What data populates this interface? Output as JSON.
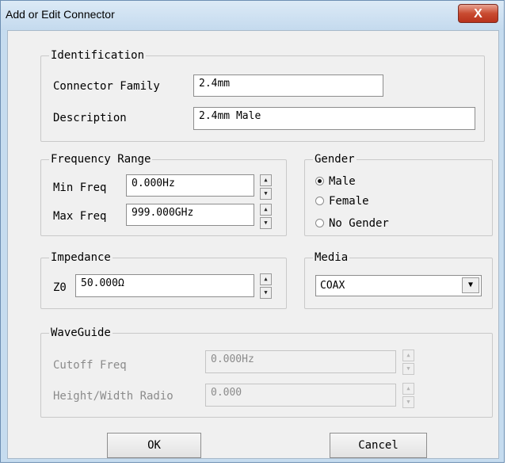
{
  "window": {
    "title": "Add or Edit Connector",
    "close_glyph": "X"
  },
  "identification": {
    "legend": "Identification",
    "family_label": "Connector Family",
    "family_value": "2.4mm",
    "description_label": "Description",
    "description_value": "2.4mm Male"
  },
  "frequency": {
    "legend": "Frequency Range",
    "min_label": "Min Freq",
    "min_value": "0.000Hz",
    "max_label": "Max Freq",
    "max_value": "999.000GHz"
  },
  "gender": {
    "legend": "Gender",
    "options": [
      "Male",
      "Female",
      "No Gender"
    ],
    "selected": "Male"
  },
  "impedance": {
    "legend": "Impedance",
    "z0_label": "Z0",
    "z0_value": "50.000Ω"
  },
  "media": {
    "legend": "Media",
    "selected": "COAX"
  },
  "waveguide": {
    "legend": "WaveGuide",
    "cutoff_label": "Cutoff Freq",
    "cutoff_value": "0.000Hz",
    "ratio_label": "Height/Width Radio",
    "ratio_value": "0.000"
  },
  "buttons": {
    "ok": "OK",
    "cancel": "Cancel"
  },
  "icons": {
    "spin_up": "▲",
    "spin_down": "▼",
    "dropdown": "▼"
  }
}
